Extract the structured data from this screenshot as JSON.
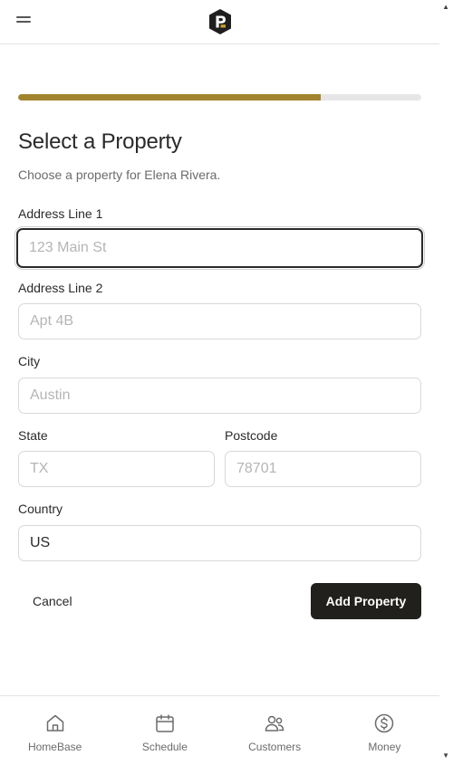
{
  "header": {
    "menu_icon": "hamburger-menu-icon",
    "logo_icon": "brand-logo-icon"
  },
  "progress": {
    "fraction": 0.75
  },
  "page": {
    "title": "Select a Property",
    "subtitle": "Choose a property for Elena Rivera."
  },
  "form": {
    "address1": {
      "label": "Address Line 1",
      "placeholder": "123 Main St",
      "value": ""
    },
    "address2": {
      "label": "Address Line 2",
      "placeholder": "Apt 4B",
      "value": ""
    },
    "city": {
      "label": "City",
      "placeholder": "Austin",
      "value": ""
    },
    "state": {
      "label": "State",
      "placeholder": "TX",
      "value": ""
    },
    "postcode": {
      "label": "Postcode",
      "placeholder": "78701",
      "value": ""
    },
    "country": {
      "label": "Country",
      "placeholder": "",
      "value": "US"
    }
  },
  "actions": {
    "cancel_label": "Cancel",
    "submit_label": "Add Property"
  },
  "nav": {
    "items": [
      {
        "label": "HomeBase",
        "icon": "home-icon"
      },
      {
        "label": "Schedule",
        "icon": "calendar-icon"
      },
      {
        "label": "Customers",
        "icon": "customers-icon"
      },
      {
        "label": "Money",
        "icon": "dollar-icon"
      }
    ]
  },
  "colors": {
    "accent": "#a2832e",
    "primary_button": "#22201c",
    "focus_border": "#2a2a2a"
  }
}
